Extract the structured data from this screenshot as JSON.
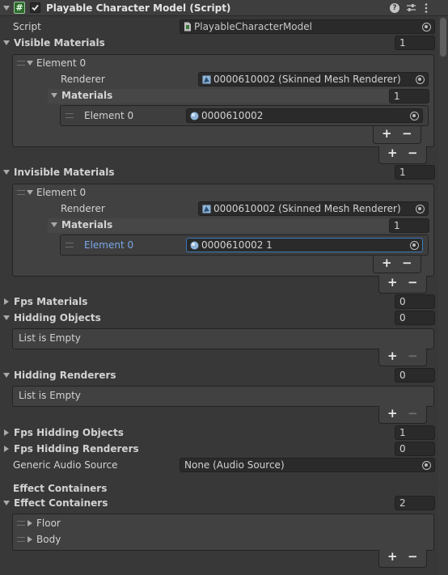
{
  "header": {
    "title": "Playable Character Model (Script)",
    "enabled": true,
    "icons": [
      "help-icon",
      "presets-icon",
      "more-icon"
    ]
  },
  "script_row": {
    "label": "Script",
    "value": "PlayableCharacterModel"
  },
  "visible_materials": {
    "label": "Visible Materials",
    "count": "1",
    "element_label": "Element 0",
    "renderer_label": "Renderer",
    "renderer_value": "0000610002 (Skinned Mesh Renderer)",
    "materials_label": "Materials",
    "materials_count": "1",
    "material_element_label": "Element 0",
    "material_value": "0000610002"
  },
  "invisible_materials": {
    "label": "Invisible Materials",
    "count": "1",
    "element_label": "Element 0",
    "renderer_label": "Renderer",
    "renderer_value": "0000610002 (Skinned Mesh Renderer)",
    "materials_label": "Materials",
    "materials_count": "1",
    "material_element_label": "Element 0",
    "material_value": "0000610002 1"
  },
  "fps_materials": {
    "label": "Fps Materials",
    "count": "0"
  },
  "hidding_objects": {
    "label": "Hidding Objects",
    "count": "0",
    "empty_text": "List is Empty"
  },
  "hidding_renderers": {
    "label": "Hidding Renderers",
    "count": "0",
    "empty_text": "List is Empty"
  },
  "fps_hidding_objects": {
    "label": "Fps Hidding Objects",
    "count": "1"
  },
  "fps_hidding_renderers": {
    "label": "Fps Hidding Renderers",
    "count": "0"
  },
  "generic_audio_source": {
    "label": "Generic Audio Source",
    "value": "None (Audio Source)"
  },
  "effect_containers_header": "Effect Containers",
  "effect_containers": {
    "label": "Effect Containers",
    "count": "2",
    "items": [
      "Floor",
      "Body"
    ]
  },
  "buttons": {
    "plus": "+",
    "minus": "−"
  },
  "colors": {
    "background": "#383838",
    "field": "#2a2a2a",
    "focus": "#3a79bb",
    "focus_text": "#7aa8e8"
  }
}
